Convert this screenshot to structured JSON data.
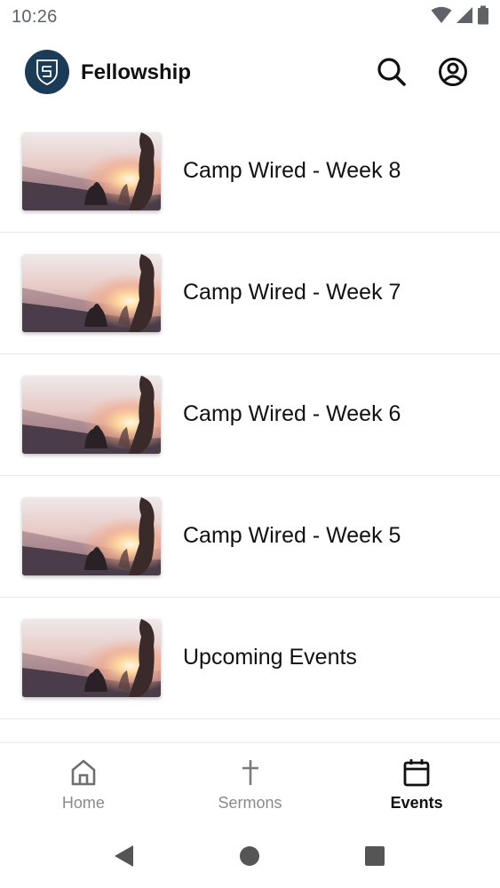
{
  "status_bar": {
    "time": "10:26",
    "icons": [
      "wifi-icon",
      "signal-icon",
      "battery-icon"
    ]
  },
  "app_bar": {
    "title": "Fellowship",
    "logo_icon": "shield-logo",
    "actions": [
      "search-icon",
      "account-icon"
    ],
    "brand_color": "#1c3b57"
  },
  "event_list": {
    "items": [
      {
        "title": "Camp Wired - Week 8"
      },
      {
        "title": "Camp Wired - Week 7"
      },
      {
        "title": "Camp Wired - Week 6"
      },
      {
        "title": "Camp Wired - Week 5"
      },
      {
        "title": "Upcoming Events"
      }
    ]
  },
  "bottom_nav": {
    "tabs": [
      {
        "label": "Home",
        "icon": "home-icon",
        "active": false
      },
      {
        "label": "Sermons",
        "icon": "cross-icon",
        "active": false
      },
      {
        "label": "Events",
        "icon": "calendar-icon",
        "active": true
      }
    ]
  },
  "system_nav": {
    "buttons": [
      "back-icon",
      "home-circle-icon",
      "recents-icon"
    ]
  }
}
